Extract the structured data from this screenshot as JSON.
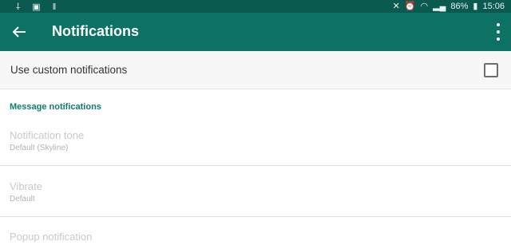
{
  "status_bar": {
    "battery": "86%",
    "time": "15:06"
  },
  "app_bar": {
    "title": "Notifications"
  },
  "custom_notifications": {
    "label": "Use custom notifications",
    "checked": false
  },
  "section": {
    "title": "Message notifications"
  },
  "preferences": [
    {
      "title": "Notification tone",
      "summary": "Default (Skyline)"
    },
    {
      "title": "Vibrate",
      "summary": "Default"
    },
    {
      "title": "Popup notification",
      "summary": ""
    }
  ],
  "colors": {
    "status_bar": "#0b5a4f",
    "app_bar": "#0c7263",
    "accent": "#0c7e72"
  }
}
